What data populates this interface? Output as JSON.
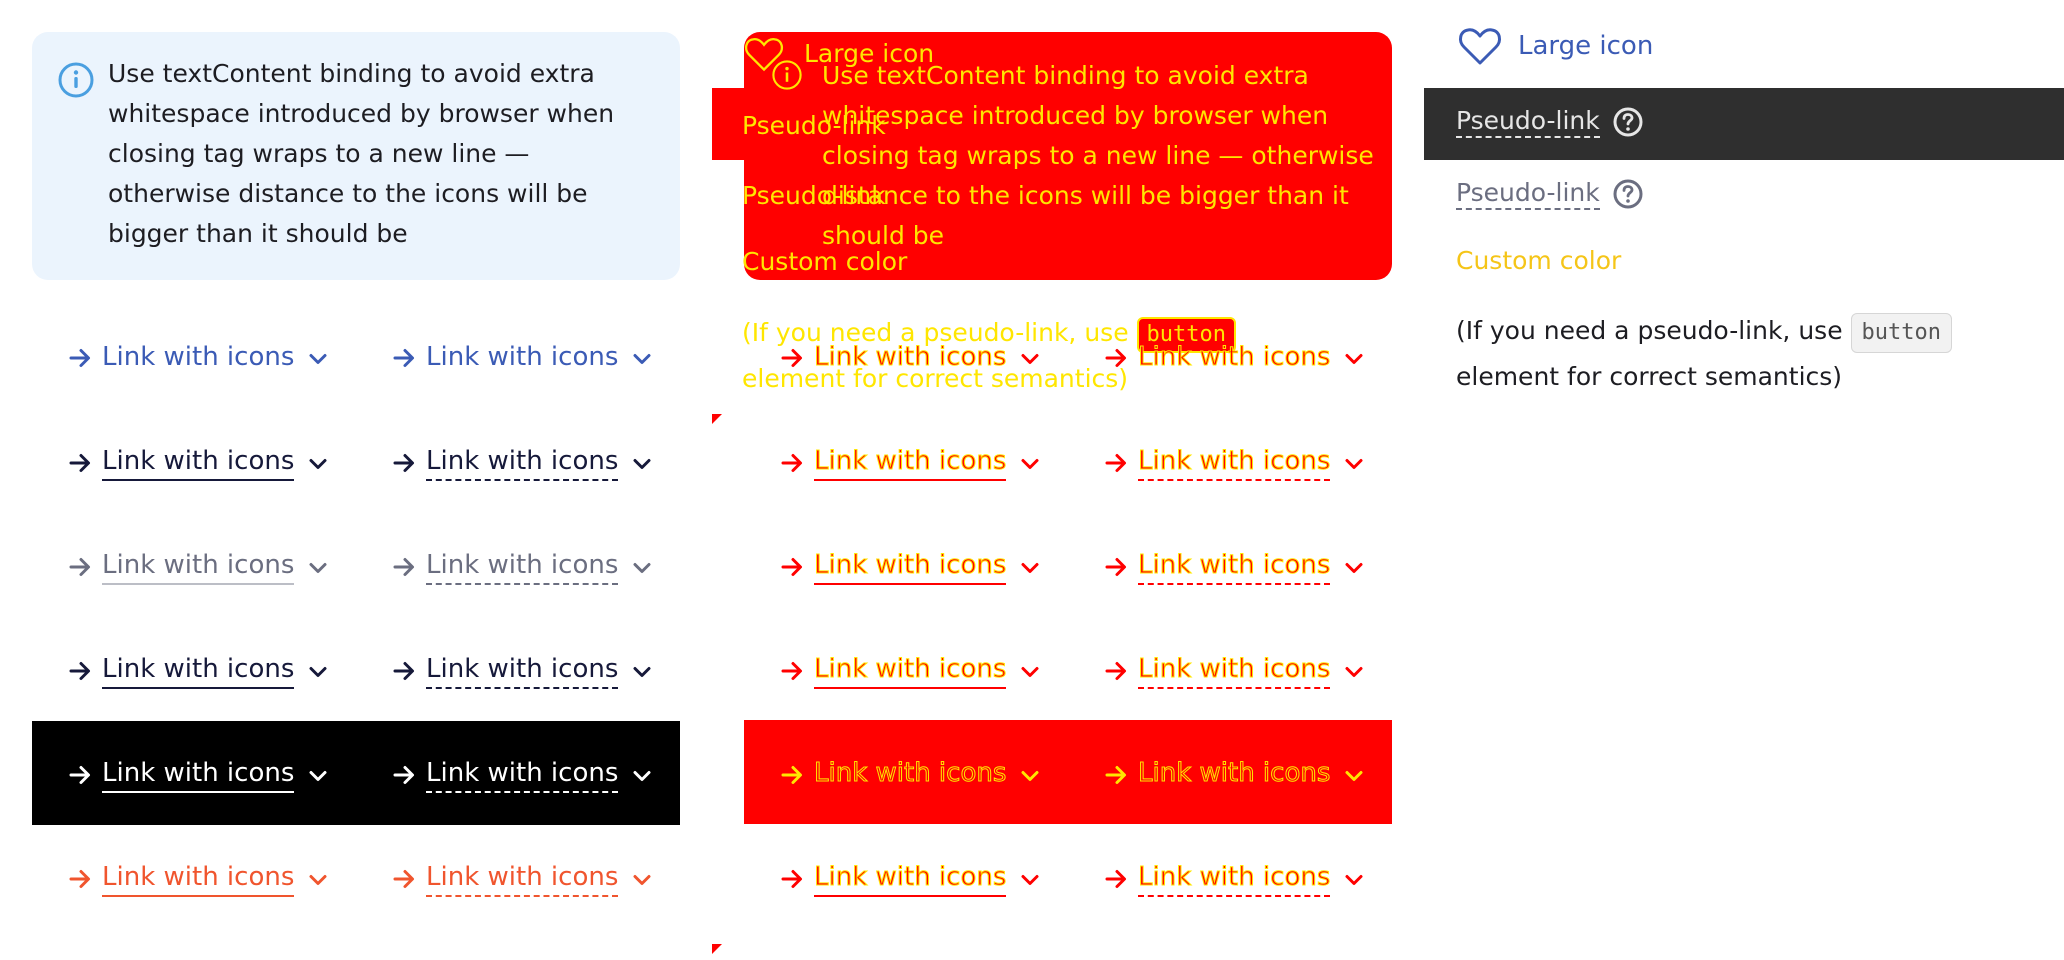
{
  "info": {
    "text": "Use textContent binding to avoid extra whitespace introduced by browser when closing tag wraps to a new line — otherwise distance to the icons will be bigger than it should be"
  },
  "link_label": "Link with icons",
  "large_icon_label": "Large icon",
  "pseudo_link_label": "Pseudo-link",
  "custom_color_label": "Custom color",
  "semantics": {
    "before": "(If you need a pseudo-link, use",
    "code": "button",
    "after": "element for correct semantics)"
  },
  "overlay": {
    "line1": "Use textContent binding to avoid extra",
    "line2": "whitespace introduced by browser when",
    "line3": "closing tag wraps to a new line — otherwise",
    "line4": "distance to the icons will be bigger than it",
    "line5": "should be"
  },
  "colors": {
    "blue": "#3b5bb5",
    "dark": "#16193a",
    "gray": "#6b6e80",
    "orange": "#f0552e",
    "debug_red": "#ff0000",
    "debug_yellow": "#ffe600",
    "custom": "#f5c518"
  },
  "icons": [
    "info-icon",
    "arrow-right-icon",
    "chevron-down-icon",
    "heart-icon",
    "question-circle-icon"
  ]
}
